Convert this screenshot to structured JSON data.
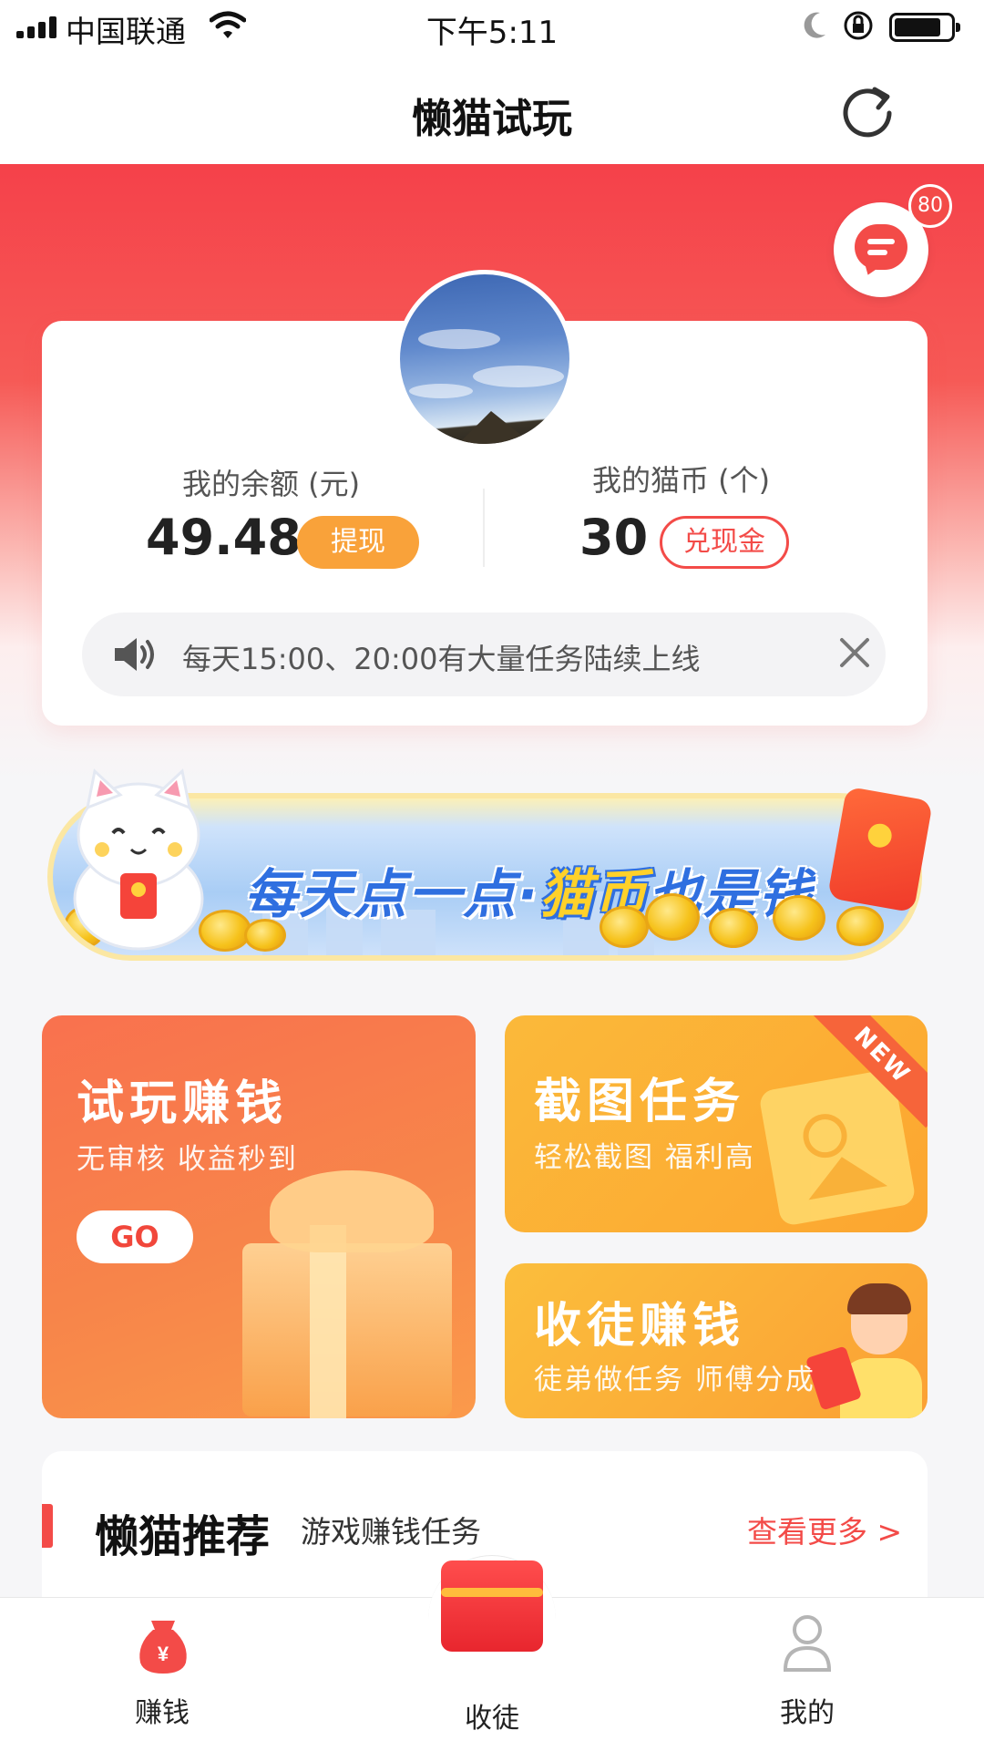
{
  "status_bar": {
    "carrier": "中国联通",
    "time": "下午5:11"
  },
  "nav": {
    "title": "懒猫试玩"
  },
  "messages": {
    "badge_count": "80"
  },
  "account": {
    "balance_label": "我的余额 (元)",
    "balance_value": "49.48",
    "withdraw_label": "提现",
    "coins_label": "我的猫币 (个)",
    "coins_value": "30",
    "exchange_label": "兑现金"
  },
  "notice": {
    "text": "每天15:00、20:00有大量任务陆续上线"
  },
  "banner": {
    "text_part1": "每天点一点·",
    "text_highlight": "猫币",
    "text_part2": "也是钱"
  },
  "tiles": {
    "trial": {
      "title": "试玩赚钱",
      "subtitle": "无审核 收益秒到",
      "button": "GO"
    },
    "screenshot": {
      "title": "截图任务",
      "subtitle": "轻松截图 福利高",
      "ribbon": "NEW"
    },
    "invite": {
      "title": "收徒赚钱",
      "subtitle": "徒弟做任务 师傅分成"
    }
  },
  "recommend": {
    "title": "懒猫推荐",
    "subtitle": "游戏赚钱任务",
    "more": "查看更多 >"
  },
  "tabbar": {
    "items": [
      {
        "label": "赚钱",
        "icon": "money-bag-icon"
      },
      {
        "label": "收徒",
        "icon": "red-envelope-icon"
      },
      {
        "label": "我的",
        "icon": "user-icon"
      }
    ]
  },
  "colors": {
    "brand_red": "#f34b48",
    "orange": "#f9a23a",
    "tile_orange": "#f9714e",
    "tile_yellow": "#fbb93a"
  }
}
